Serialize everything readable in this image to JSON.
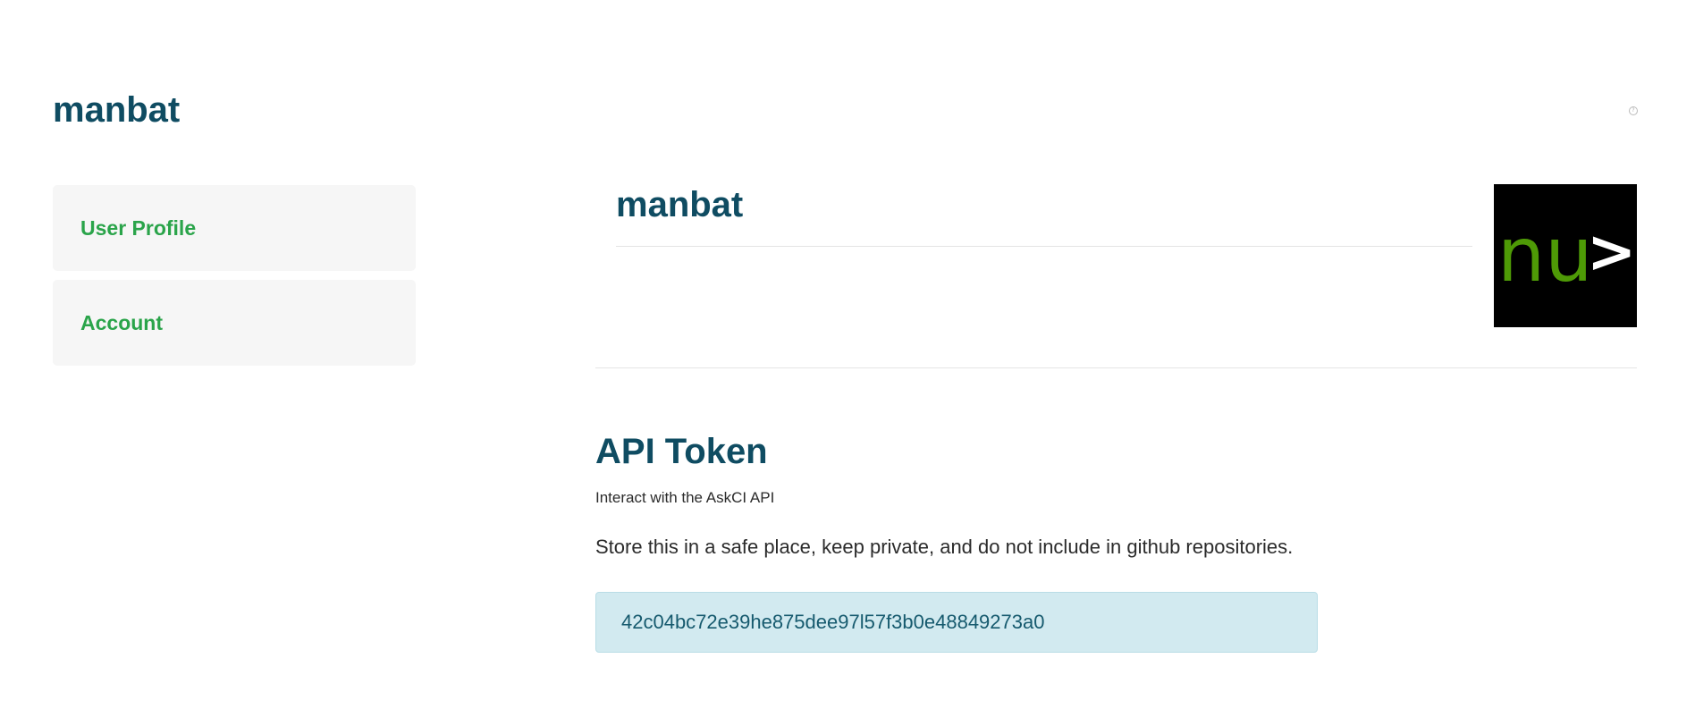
{
  "header": {
    "site_title": "manbat",
    "help_icon": "help-circle-icon"
  },
  "sidebar": {
    "items": [
      {
        "label": "User Profile"
      },
      {
        "label": "Account"
      }
    ]
  },
  "profile": {
    "name": "manbat",
    "avatar_text_green": "nu",
    "avatar_text_white": ">"
  },
  "api": {
    "title": "API Token",
    "subtitle": "Interact with the AskCI API",
    "warning": "Store this in a safe place, keep private, and do not include in github repositories.",
    "token": "42c04bc72e39he875dee97l57f3b0e48849273a0"
  },
  "colors": {
    "heading": "#0f4c62",
    "link_green": "#2aa44a",
    "sidebar_bg": "#f6f6f6",
    "token_bg": "#d2eaf0",
    "token_text": "#165a6e",
    "avatar_bg": "#000000",
    "avatar_green": "#4e9a06"
  }
}
